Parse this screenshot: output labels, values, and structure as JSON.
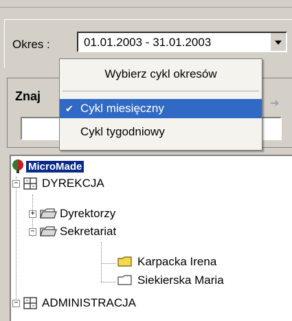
{
  "period": {
    "label": "Okres :",
    "value": "01.01.2003 - 31.01.2003"
  },
  "search": {
    "label": "Znaj",
    "input_value": ""
  },
  "menu": {
    "header": "Wybierz cykl okresów",
    "items": [
      {
        "label": "Cykl miesięczny",
        "checked": true
      },
      {
        "label": "Cykl tygodniowy",
        "checked": false
      }
    ]
  },
  "tree": {
    "root": "MicroMade",
    "nodes": [
      {
        "label": "DYREKCJA",
        "expander": "−"
      },
      {
        "label": "Dyrektorzy",
        "expander": "+"
      },
      {
        "label": "Sekretariat",
        "expander": "−"
      },
      {
        "label": "Karpacka Irena"
      },
      {
        "label": "Siekierska Maria"
      },
      {
        "label": "ADMINISTRACJA",
        "expander": "−"
      }
    ]
  },
  "colors": {
    "selection": "#316ac5",
    "root_highlight": "#0a2a8a",
    "folder_yellow": "#f5d94a"
  }
}
